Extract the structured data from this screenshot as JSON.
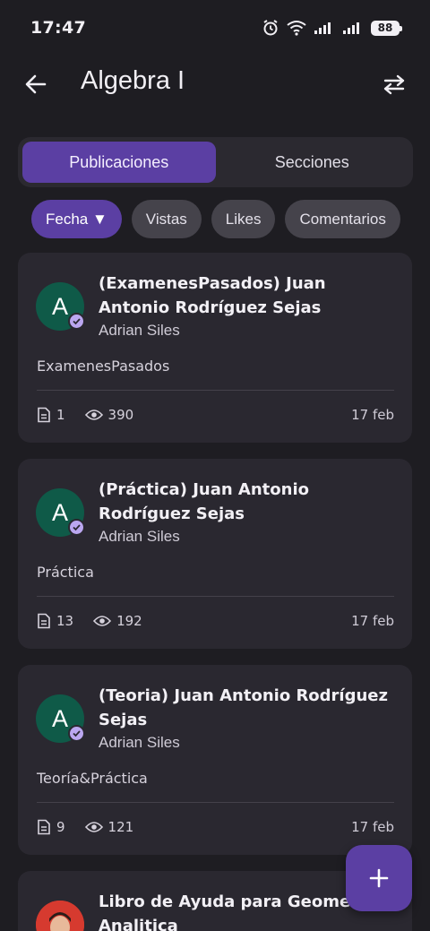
{
  "status": {
    "time": "17:47",
    "battery": "88"
  },
  "header": {
    "title": "Algebra I"
  },
  "tabs": [
    {
      "label": "Publicaciones",
      "active": true
    },
    {
      "label": "Secciones",
      "active": false
    }
  ],
  "filters": [
    {
      "label": "Fecha ▼",
      "active": true
    },
    {
      "label": "Vistas",
      "active": false
    },
    {
      "label": "Likes",
      "active": false
    },
    {
      "label": "Comentarios",
      "active": false
    }
  ],
  "posts": [
    {
      "avatar_letter": "A",
      "title": "(ExamenesPasados) Juan Antonio Rodríguez Sejas",
      "author": "Adrian Siles",
      "tag": "ExamenesPasados",
      "files": "1",
      "views": "390",
      "date": "17 feb"
    },
    {
      "avatar_letter": "A",
      "title": "(Práctica) Juan Antonio Rodríguez Sejas",
      "author": "Adrian Siles",
      "tag": "Práctica",
      "files": "13",
      "views": "192",
      "date": "17 feb"
    },
    {
      "avatar_letter": "A",
      "title": "(Teoria) Juan Antonio Rodríguez Sejas",
      "author": "Adrian Siles",
      "tag": "Teoría&Práctica",
      "files": "9",
      "views": "121",
      "date": "17 feb"
    },
    {
      "title": "Libro de Ayuda para Geometría Analitica"
    }
  ],
  "colors": {
    "accent": "#5b3fa3",
    "background": "#1e1d22",
    "card": "#2a2830",
    "avatar": "#0f5a48"
  },
  "icons": {
    "back": "arrow-left-icon",
    "swap": "swap-horizontal-icon",
    "add": "plus-icon",
    "files": "document-icon",
    "views": "eye-icon",
    "verified": "verified-check-icon"
  }
}
